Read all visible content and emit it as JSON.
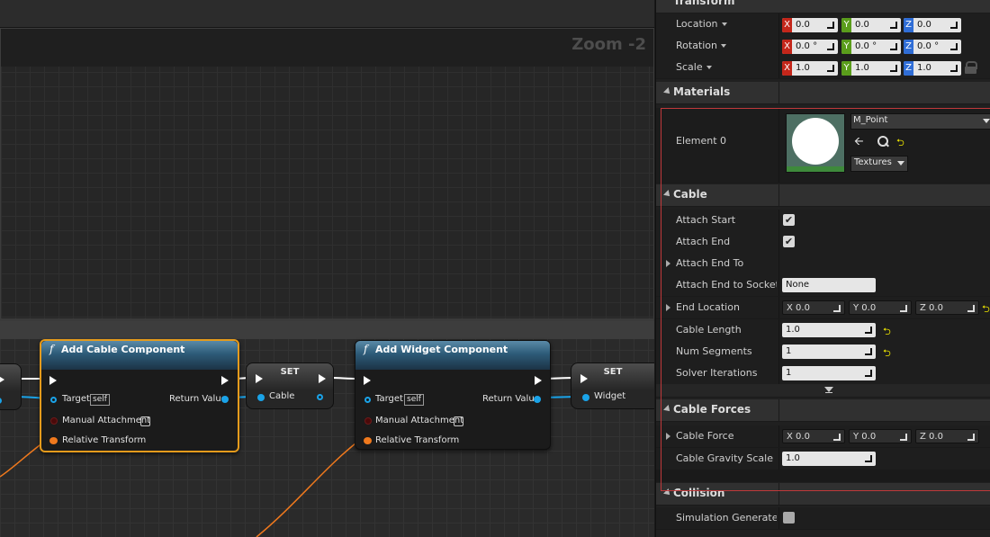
{
  "graph": {
    "zoom": "Zoom -2",
    "nodes": {
      "cable_comp": {
        "title": "Add Cable Component",
        "target": "Target",
        "self": "self",
        "return_value": "Return Value",
        "manual_attachment": "Manual Attachment",
        "relative_transform": "Relative Transform"
      },
      "set_cable": {
        "title": "SET",
        "pin": "Cable"
      },
      "widget_comp": {
        "title": "Add Widget Component",
        "target": "Target",
        "self": "self",
        "return_value": "Return Value",
        "manual_attachment": "Manual Attachment",
        "relative_transform": "Relative Transform"
      },
      "set_widget": {
        "title": "SET",
        "pin": "Widget"
      }
    },
    "function_icon": "f"
  },
  "details": {
    "transform": {
      "title": "Transform",
      "location": {
        "label": "Location",
        "x": "0.0",
        "y": "0.0",
        "z": "0.0"
      },
      "rotation": {
        "label": "Rotation",
        "x": "0.0 °",
        "y": "0.0 °",
        "z": "0.0 °"
      },
      "scale": {
        "label": "Scale",
        "x": "1.0",
        "y": "1.0",
        "z": "1.0"
      },
      "axis": {
        "x": "X",
        "y": "Y",
        "z": "Z"
      }
    },
    "materials": {
      "title": "Materials",
      "element0": "Element 0",
      "material": "M_Point",
      "textures": "Textures"
    },
    "cable": {
      "title": "Cable",
      "attach_start": "Attach Start",
      "attach_end": "Attach End",
      "attach_end_to": "Attach End To",
      "attach_end_socket": "Attach End to Socket N",
      "attach_end_socket_value": "None",
      "end_location": {
        "label": "End Location",
        "x": "X  0.0",
        "y": "Y  0.0",
        "z": "Z  0.0"
      },
      "cable_length": {
        "label": "Cable Length",
        "value": "1.0"
      },
      "num_segments": {
        "label": "Num Segments",
        "value": "1"
      },
      "solver_iterations": {
        "label": "Solver Iterations",
        "value": "1"
      }
    },
    "cable_forces": {
      "title": "Cable Forces",
      "cable_force": {
        "label": "Cable Force",
        "x": "X  0.0",
        "y": "Y  0.0",
        "z": "Z  0.0"
      },
      "gravity_scale": {
        "label": "Cable Gravity Scale",
        "value": "1.0"
      }
    },
    "collision": {
      "title": "Collision",
      "sim_generates": "Simulation Generates I"
    },
    "colors": {
      "x_axis": "#c4261a",
      "y_axis": "#5a9d1b",
      "z_axis": "#2f6dd6",
      "highlight": "#c0393b",
      "selection": "#e59b1c"
    }
  }
}
